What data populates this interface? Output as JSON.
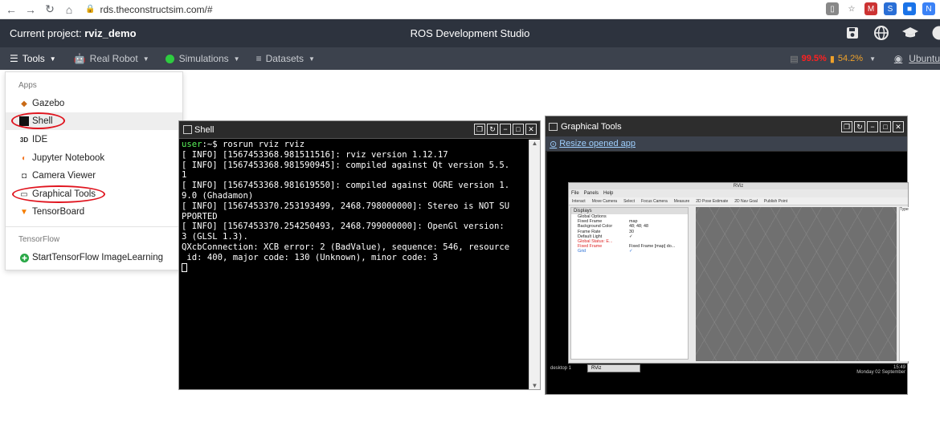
{
  "browser": {
    "url": "rds.theconstructsim.com/#"
  },
  "header": {
    "project_prefix": "Current project: ",
    "project_name": "rviz_demo",
    "title": "ROS Development Studio"
  },
  "toolbar": {
    "tools": "Tools",
    "real_robot": "Real Robot",
    "simulations": "Simulations",
    "datasets": "Datasets",
    "cpu": "99.5%",
    "mem": "54.2%",
    "ubuntu": "Ubuntu"
  },
  "menu": {
    "apps_label": "Apps",
    "items": [
      {
        "label": "Gazebo"
      },
      {
        "label": "Shell"
      },
      {
        "label": "IDE"
      },
      {
        "label": "Jupyter Notebook"
      },
      {
        "label": "Camera Viewer"
      },
      {
        "label": "Graphical Tools"
      },
      {
        "label": "TensorBoard"
      }
    ],
    "tf_label": "TensorFlow",
    "tf_item": "StartTensorFlow ImageLearning"
  },
  "shell": {
    "title": "Shell",
    "prompt_user": "user",
    "prompt_rest": ":~$ rosrun rviz rviz",
    "lines": [
      "[ INFO] [1567453368.981511516]: rviz version 1.12.17",
      "[ INFO] [1567453368.981590945]: compiled against Qt version 5.5.",
      "1",
      "[ INFO] [1567453368.981619550]: compiled against OGRE version 1.",
      "9.0 (Ghadamon)",
      "[ INFO] [1567453370.253193499, 2468.798000000]: Stereo is NOT SU",
      "PPORTED",
      "[ INFO] [1567453370.254250493, 2468.799000000]: OpenGl version:",
      "3 (GLSL 1.3).",
      "QXcbConnection: XCB error: 2 (BadValue), sequence: 546, resource",
      " id: 400, major code: 130 (Unknown), minor code: 3"
    ]
  },
  "graphical_tools": {
    "title": "Graphical Tools",
    "resize_link": "Resize opened app",
    "rviz": {
      "title": "RViz",
      "menu": [
        "File",
        "Panels",
        "Help"
      ],
      "tools": [
        "Interact",
        "Move Camera",
        "Select",
        "Focus Camera",
        "Measure",
        "2D Pose Estimate",
        "2D Nav Goal",
        "Publish Point"
      ],
      "panel_title": "Displays",
      "rows": [
        {
          "k": "Global Options",
          "v": ""
        },
        {
          "k": "Fixed Frame",
          "v": "map"
        },
        {
          "k": "Background Color",
          "v": "48; 48; 48"
        },
        {
          "k": "Frame Rate",
          "v": "30"
        },
        {
          "k": "Default Light",
          "v": "✓"
        },
        {
          "k": "Global Status: E...",
          "v": ""
        },
        {
          "k": "Fixed Frame",
          "v": "Fixed Frame [map] do..."
        },
        {
          "k": "Grid",
          "v": "✓"
        }
      ],
      "side_label": "Type"
    },
    "taskbar": {
      "desktop": "desktop 1",
      "task": "RViz",
      "time": "15:49",
      "date": "Monday 02 September"
    }
  }
}
